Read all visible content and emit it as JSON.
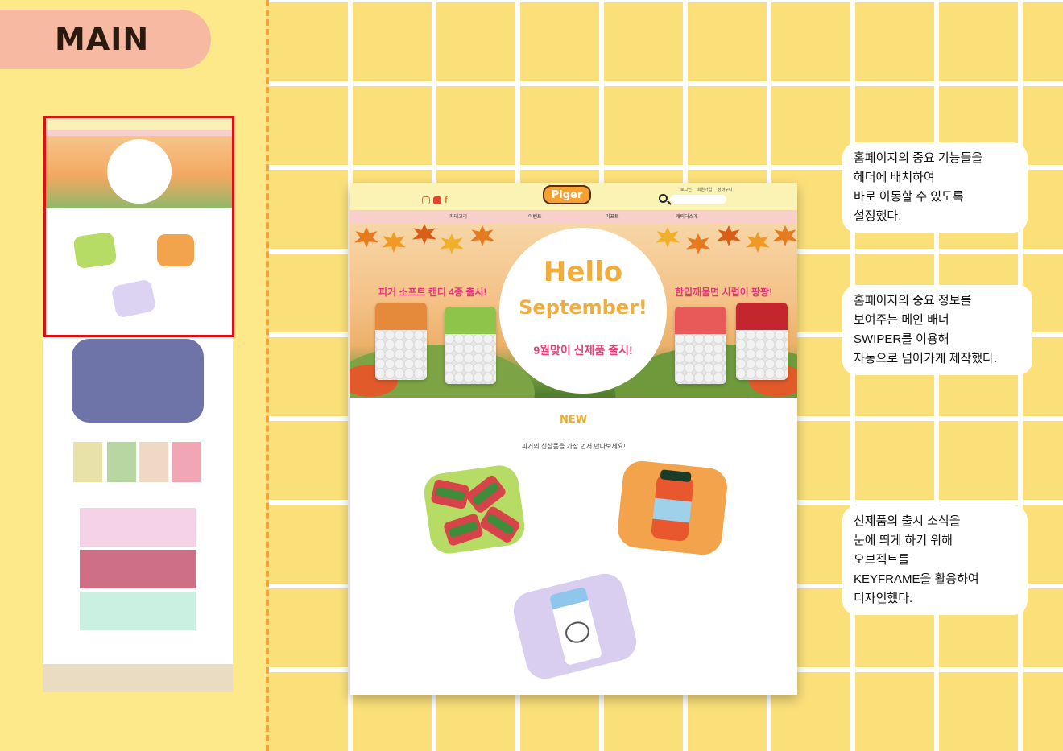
{
  "section_label": "MAIN",
  "header": {
    "social_icons": [
      "instagram-icon",
      "youtube-icon",
      "facebook-icon"
    ],
    "logo_text": "Piger",
    "util_links": [
      "로그인",
      "회원가입",
      "장바구니"
    ],
    "search_placeholder": ""
  },
  "nav": {
    "items": [
      "카테고리",
      "이벤트",
      "기프트",
      "캐릭터소개"
    ]
  },
  "banner": {
    "hello": "Hello",
    "september": "September!",
    "subtitle": "9월맞이 신제품 출시!",
    "left_caption": "피거 소프트 캔디 4종 출시!",
    "right_caption": "한입깨물면 시럽이 팡팡!",
    "box_brand": "Piger"
  },
  "new_section": {
    "title": "NEW",
    "description": "피거의 신상품을 가장 먼저 만나보세요!"
  },
  "notes": [
    {
      "lines": [
        "홈페이지의 중요 기능들을",
        "헤더에 배치하여",
        "바로 이동할 수 있도록",
        "설정했다."
      ]
    },
    {
      "lines": [
        "홈페이지의 중요 정보를",
        "보여주는 메인 배너",
        "SWIPER를 이용해",
        "자동으로 넘어가게 제작했다."
      ]
    },
    {
      "lines": [
        "신제품의 출시 소식을",
        "눈에 띄게 하기 위해",
        "오브젝트를",
        "KEYFRAME을 활용하여",
        "디자인했다."
      ]
    }
  ],
  "colors": {
    "background": "#fbe07a",
    "pill": "#f8b9a2",
    "divider": "#f4a23c",
    "highlight_frame": "#e01010",
    "accent_text": "#f1ab2a",
    "pink_text": "#e3377a"
  }
}
